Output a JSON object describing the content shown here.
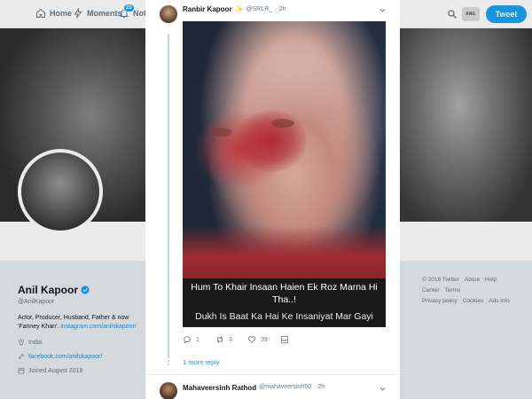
{
  "topnav": {
    "home_label": "Home",
    "moments_label": "Moments",
    "notifications_label": "Notif",
    "notifications_badge": "20",
    "avatar_text": "ANIL",
    "tweet_button_label": "Tweet"
  },
  "profile": {
    "name": "Anil Kapoor",
    "handle": "@AnilKapoor",
    "bio_text": "Actor, Producer, Husband, Father & now 'Fanney Khan'.",
    "bio_link": "instagram.com/anilskapoor/",
    "location": "India",
    "website": "facebook.com/anilskapoor/",
    "joined": "Joined August 2018"
  },
  "footer": {
    "links": [
      "© 2018 Twitter",
      "About",
      "Help Center",
      "Terms",
      "Privacy policy",
      "Cookies",
      "Ads info"
    ]
  },
  "tweet": {
    "author_name": "Ranbir Kapoor",
    "star_icon": "star-icon",
    "handle": "@SRLR_",
    "time": "· 2h",
    "caption_line1": "Hum To Khair Insaan Haien Ek Roz Marna Hi",
    "caption_line2": "Tha..!",
    "caption_line3": "Dukh Is Baat Ka Hai Ke Insaniyat Mar Gayi",
    "replies": "1",
    "retweets": "3",
    "likes": "39",
    "more_replies": "1 more reply"
  },
  "reply": {
    "author_name": "Mahaveersinh Rathod",
    "handle": "@mahaveersinh50",
    "time": "· 2h"
  },
  "colors": {
    "accent": "#1da1f2",
    "link": "#1b95e0",
    "muted": "#657786"
  }
}
